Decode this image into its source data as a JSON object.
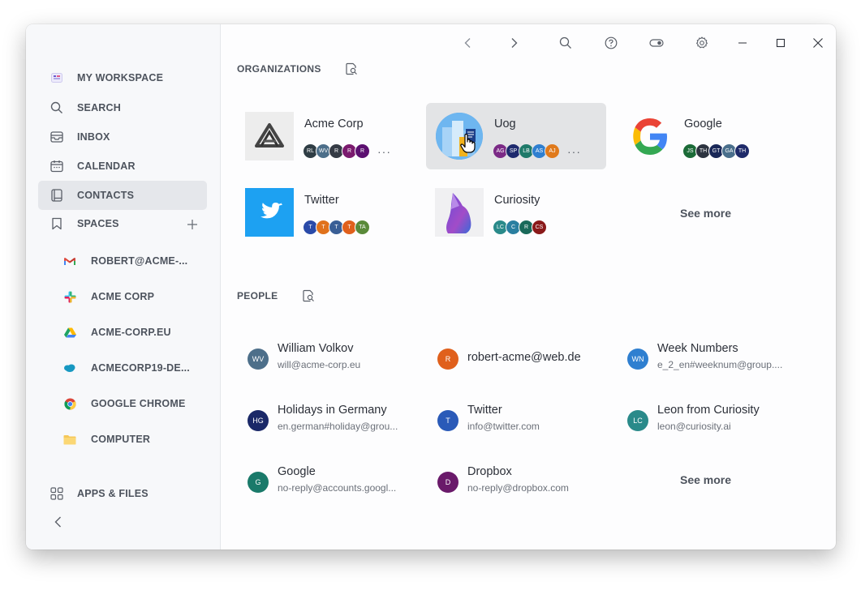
{
  "sidebar": {
    "nav": [
      {
        "label": "MY WORKSPACE",
        "icon": "workspace-icon"
      },
      {
        "label": "SEARCH",
        "icon": "search-icon"
      },
      {
        "label": "INBOX",
        "icon": "inbox-icon"
      },
      {
        "label": "CALENDAR",
        "icon": "calendar-icon"
      },
      {
        "label": "CONTACTS",
        "icon": "contacts-icon",
        "active": true
      }
    ],
    "spaces_label": "SPACES",
    "spaces": [
      {
        "label": "ROBERT@ACME-...",
        "icon": "gmail-icon"
      },
      {
        "label": "ACME CORP",
        "icon": "slack-icon"
      },
      {
        "label": "ACME-CORP.EU",
        "icon": "google-drive-icon"
      },
      {
        "label": "ACMECORP19-DE...",
        "icon": "salesforce-icon"
      },
      {
        "label": "GOOGLE CHROME",
        "icon": "chrome-icon"
      },
      {
        "label": "COMPUTER",
        "icon": "folder-icon"
      }
    ],
    "apps_label": "APPS & FILES"
  },
  "organizations": {
    "title": "ORGANIZATIONS",
    "items": [
      {
        "name": "Acme Corp",
        "members": [
          {
            "initials": "RL",
            "color": "#2f3d45"
          },
          {
            "initials": "WV",
            "color": "#4d6f8a"
          },
          {
            "initials": "R",
            "color": "#353b45"
          },
          {
            "initials": "R",
            "color": "#7a1a6e"
          },
          {
            "initials": "R",
            "color": "#5c1070"
          }
        ],
        "more": "···"
      },
      {
        "name": "Uog",
        "members": [
          {
            "initials": "AG",
            "color": "#7b2a86"
          },
          {
            "initials": "SP",
            "color": "#1e2a6e"
          },
          {
            "initials": "LB",
            "color": "#1f7a6a"
          },
          {
            "initials": "AS",
            "color": "#2f7fd0"
          },
          {
            "initials": "AJ",
            "color": "#e07a1c"
          }
        ],
        "more": "···"
      },
      {
        "name": "Google",
        "members": [
          {
            "initials": "JS",
            "color": "#1c6b38"
          },
          {
            "initials": "TH",
            "color": "#2d3440"
          },
          {
            "initials": "GT",
            "color": "#1a2858"
          },
          {
            "initials": "GA",
            "color": "#4a6f8c"
          },
          {
            "initials": "TH",
            "color": "#1f2b6a"
          }
        ]
      },
      {
        "name": "Twitter",
        "members": [
          {
            "initials": "T",
            "color": "#2a4aa8"
          },
          {
            "initials": "T",
            "color": "#e0721c"
          },
          {
            "initials": "T",
            "color": "#3a5f96"
          },
          {
            "initials": "T",
            "color": "#e0601c"
          },
          {
            "initials": "TA",
            "color": "#5a8a3a"
          }
        ]
      },
      {
        "name": "Curiosity",
        "members": [
          {
            "initials": "LC",
            "color": "#2a8a8a"
          },
          {
            "initials": "C",
            "color": "#2a7fa0"
          },
          {
            "initials": "R",
            "color": "#1a6a5a"
          },
          {
            "initials": "CS",
            "color": "#8a1a1a"
          }
        ]
      }
    ],
    "see_more": "See more"
  },
  "people": {
    "title": "PEOPLE",
    "items": [
      {
        "name": "William Volkov",
        "email": "will@acme-corp.eu",
        "initials": "WV",
        "color": "#4d6f8a"
      },
      {
        "name": "robert-acme@web.de",
        "email": "",
        "initials": "R",
        "color": "#e0601c"
      },
      {
        "name": "Week Numbers",
        "email": "e_2_en#weeknum@group....",
        "initials": "WN",
        "color": "#2f7fd0"
      },
      {
        "name": "Holidays in Germany",
        "email": "en.german#holiday@grou...",
        "initials": "HG",
        "color": "#1a2868"
      },
      {
        "name": "Twitter",
        "email": "info@twitter.com",
        "initials": "T",
        "color": "#2a5ab8"
      },
      {
        "name": "Leon from Curiosity",
        "email": "leon@curiosity.ai",
        "initials": "LC",
        "color": "#2a8a8a"
      },
      {
        "name": "Google",
        "email": "no-reply@accounts.googl...",
        "initials": "G",
        "color": "#1a7a6a"
      },
      {
        "name": "Dropbox",
        "email": "no-reply@dropbox.com",
        "initials": "D",
        "color": "#6a1a6a"
      }
    ],
    "see_more": "See more"
  }
}
